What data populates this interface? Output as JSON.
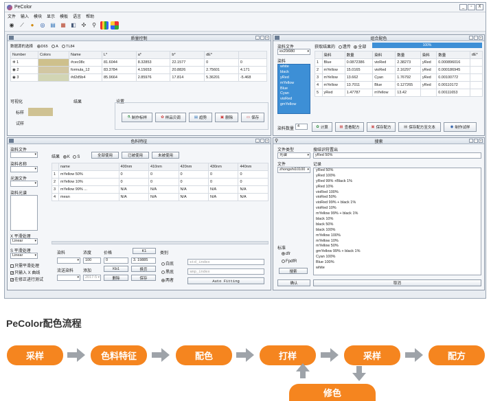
{
  "app": {
    "title": "PeColor",
    "menus": [
      "文件",
      "输入",
      "模块",
      "显示",
      "模板",
      "语言",
      "帮助"
    ],
    "win_controls": [
      "_",
      "▫",
      "X"
    ]
  },
  "toolbar_icons": [
    "camera-icon",
    "ruler-icon",
    "circle-icon",
    "target-icon",
    "document-icon",
    "chart-icon",
    "layers-icon",
    "network-icon",
    "search-icon",
    "color-bars-icon",
    "palette-icon"
  ],
  "quality": {
    "title": "质量控制",
    "data_source_label": "数据源的选择",
    "options": [
      "D65",
      "A",
      "TL84"
    ],
    "columns": [
      "Number",
      "Colors",
      "Name",
      "L*",
      "a*",
      "b*",
      "dE*"
    ],
    "rows": [
      {
        "n": "1",
        "color": "#cec08c",
        "name": "#cec08c",
        "L": "81.6044",
        "a": "8.32853",
        "b": "22.1577",
        "dE": "0",
        "x": "0"
      },
      {
        "n": "2",
        "color": "#d2c7a3",
        "name": "formula_12",
        "L": "83.3784",
        "a": "4.15653",
        "b": "20.8826",
        "dE": "2.75601",
        "x": "4.171"
      },
      {
        "n": "3",
        "color": "#d2d5b4",
        "name": "#d2d5b4",
        "L": "85.9664",
        "a": "2.85976",
        "b": "17.814",
        "dE": "5.36201",
        "x": "-5.468"
      }
    ],
    "visual_label": "可视化",
    "sample_label": "标样",
    "trial_label": "试样",
    "result_label": "结果",
    "settings_label": "设置",
    "sample_color": "#cfc293",
    "buttons": [
      "制作标样",
      "样品贝调",
      "趋势",
      "删除",
      "保存"
    ]
  },
  "match": {
    "title": "组合配色",
    "dye_file_label": "染料文件",
    "dye_file": "ex20i980",
    "dye_label": "染料",
    "dyes": [
      "white",
      "black",
      "yRed",
      "mYellow",
      "Blue",
      "Cyan",
      "vioRed",
      "gmYellow"
    ],
    "result_label": "获取结果的",
    "opt1": "遗传",
    "opt2": "全部",
    "progress": "100%",
    "columns": [
      "染料",
      "数量",
      "染料",
      "数量",
      "染料",
      "数量",
      "dE*"
    ],
    "rows": [
      [
        "1",
        "Blue",
        "0.0872386",
        "vioRed",
        "2.38273",
        "yRed",
        "0.000896016"
      ],
      [
        "2",
        "mYellow",
        "15.0165",
        "vioRed",
        "2.16297",
        "yRed",
        "0.000186945"
      ],
      [
        "3",
        "mYellow",
        "13.662",
        "Cyan",
        "1.76792",
        "yRed",
        "0.00100772"
      ],
      [
        "4",
        "mYellow",
        "13.7011",
        "Blue",
        "0.127265",
        "yRed",
        "0.00110172"
      ],
      [
        "5",
        "yRed",
        "1.47787",
        "mYellow",
        "13.42",
        "",
        "0.00111653"
      ]
    ],
    "dye_count_label": "染料数量",
    "dye_count": "4",
    "buttons": [
      "计算",
      "查看配方",
      "保存配方",
      "保存配方至文本",
      "制作试样"
    ]
  },
  "dye": {
    "title": "色料特征",
    "file_label": "染料文件",
    "name_label": "染料名称",
    "source_file_label": "光源文件",
    "dye_source_label": "染料光谱",
    "result_label": "结果",
    "opt_k": "K",
    "opt_s": "S",
    "btn_all": "全部使用",
    "btn_clear": "已被使用",
    "btn_unused": "未被使用",
    "columns": [
      "name",
      "400nm",
      "410nm",
      "420nm",
      "430nm",
      "440nm"
    ],
    "rows": [
      [
        "1",
        "mYellow 50%",
        "0",
        "0",
        "0",
        "0",
        "0"
      ],
      [
        "2",
        "mYellow 10%",
        "0",
        "0",
        "0",
        "0",
        "0"
      ],
      [
        "3",
        "mYellow 99% ...",
        "N/A",
        "N/A",
        "N/A",
        "N/A",
        "N/A"
      ],
      [
        "4",
        "mean",
        "N/A",
        "N/A",
        "N/A",
        "N/A",
        "N/A"
      ]
    ],
    "x_smooth_label": "X 平滑处理",
    "s_smooth_label": "S 平滑处理",
    "linear": "Linear",
    "only_smooth": "只需平滑处理",
    "only_input": "只输入 X 曲线",
    "lock_test": "在修正进行测试",
    "dye_col": "染料",
    "conc_label": "浓度",
    "price_label": "价格",
    "conc_val": "100",
    "price_val": "0",
    "val_3": "3. 19885",
    "btn_k": "K1",
    "flow_label": "流送染料",
    "add_label": "添加",
    "btn_mix": "Kb1",
    "btn_replace": "换页",
    "btn_delete": "删除",
    "btn_save": "保存",
    "unit": "2017-5",
    "category_label": "类别",
    "cat_white": "白底",
    "cat_black": "黑底",
    "cat_trans": "两者",
    "ref_fields": [
      "std_index",
      "smp_index"
    ],
    "auto_fit": "Auto Fitting"
  },
  "search": {
    "title": "搜索",
    "file_type_label": "文件类型",
    "file_type": "光谱",
    "query_label": "搜结识符置出",
    "query": "yRed 50%",
    "file_label": "文件",
    "file": "zhongshi10100",
    "record_label": "记录",
    "records": [
      "yRed 50%",
      "yRed 100%",
      "yRed 99% +Black 1%",
      "yRed 10%",
      "vioRed 100%",
      "vioRed 50%",
      "vioRed 99% + black 1%",
      "vioRed 10%",
      "mYellow 99% + black 1%",
      "black 10%",
      "black 50%",
      "black 100%",
      "mYellow 100%",
      "mYellow 10%",
      "mYellow 50%",
      "gmYellow 99% + black 1%",
      "Cyan 100%",
      "Blue 100%",
      "white"
    ],
    "std_label": "标准",
    "opt_dfr": "dfr",
    "opt_fpm": "FpdfR",
    "btn_search": "搜索",
    "btn_confirm": "确认",
    "btn_cancel": "取消"
  },
  "workflow": {
    "title": "PeColor配色流程",
    "steps": [
      "采样",
      "色料特征",
      "配色",
      "打样",
      "采样",
      "配方",
      "修色"
    ]
  }
}
